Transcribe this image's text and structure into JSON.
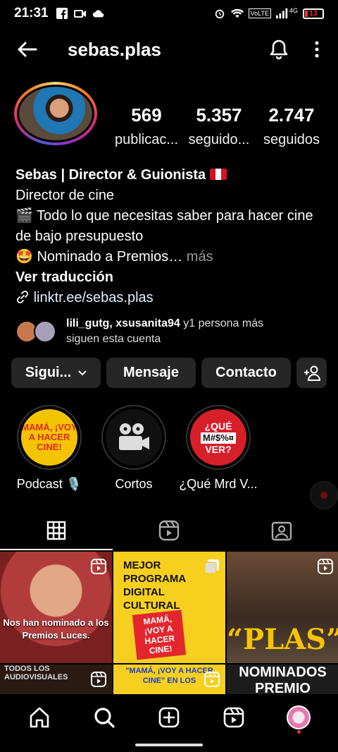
{
  "status_bar": {
    "time": "21:31",
    "network": "4G",
    "volte": "VoLTE",
    "battery": "13"
  },
  "header": {
    "username": "sebas.plas"
  },
  "stats": [
    {
      "value": "569",
      "label": "publicac..."
    },
    {
      "value": "5.357",
      "label": "seguido..."
    },
    {
      "value": "2.747",
      "label": "seguidos"
    }
  ],
  "bio": {
    "name": "Sebas | Director & Guionista",
    "line1": "Director de cine",
    "line2_emoji": "🎬",
    "line2": "Todo lo que necesitas saber para hacer cine de bajo presupuesto",
    "line3_emoji": "🤩",
    "line3": "Nominado a Premios…",
    "more": "más",
    "translate": "Ver traducción",
    "link": "linktr.ee/sebas.plas"
  },
  "followers": {
    "users": "lili_gutg, xsusanita94",
    "rest": "y1 persona más",
    "line2": "siguen esta cuenta"
  },
  "actions": {
    "follow": "Sigui...",
    "message": "Mensaje",
    "contact": "Contacto"
  },
  "highlights": [
    {
      "label": "Podcast 🎙️",
      "cover_text": "MAMÁ, ¡VOY A HACER CINE!"
    },
    {
      "label": "Cortos"
    },
    {
      "label": "¿Qué Mrd V...",
      "cover_top": "¿QUÉ",
      "cover_mid": "M#$%¤",
      "cover_bottom": "VER?"
    }
  ],
  "grid": {
    "post1_caption": "Nos han nominado a los Premios Luces.",
    "post2_text": "MEJOR PROGRAMA DIGITAL CULTURAL",
    "post2_logo": "MAMÁ, ¡VOY A HACER CINE!",
    "post3_text": "“PLAS”",
    "post4_text": "TODOS LOS AUDIOVISUALES",
    "post5_text": "\"MAMÁ, ¡VOY A HACER CINE\" EN LOS",
    "post6_text": "NOMINADOS PREMIO"
  },
  "colors": {
    "background": "#000000",
    "button_bg": "#262626",
    "muted": "#999999",
    "accent_yellow": "#f7cf1f",
    "accent_red": "#e3262e"
  }
}
